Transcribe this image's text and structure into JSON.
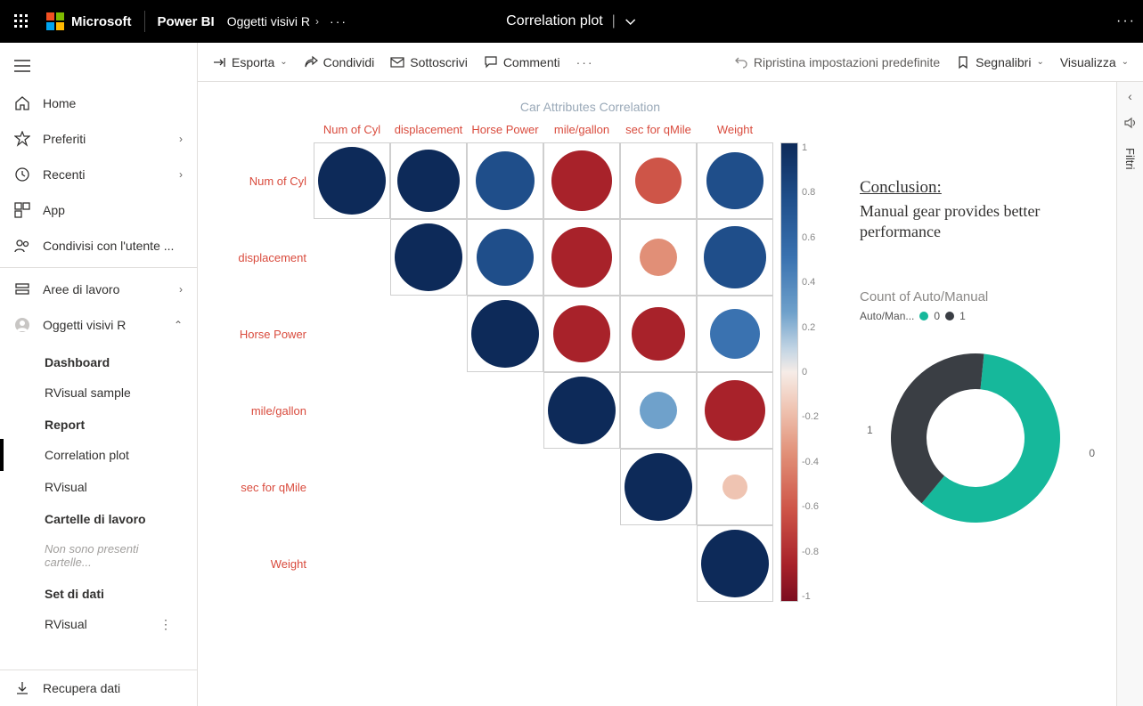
{
  "topbar": {
    "ms": "Microsoft",
    "brand": "Power BI",
    "breadcrumb": "Oggetti visivi R",
    "report_title": "Correlation plot"
  },
  "nav": {
    "home": "Home",
    "favorites": "Preferiti",
    "recent": "Recenti",
    "apps": "App",
    "shared": "Condivisi con l'utente ...",
    "workspaces": "Aree di lavoro",
    "current_ws": "Oggetti visivi R",
    "get_data": "Recupera dati"
  },
  "subnav": {
    "dashboard_head": "Dashboard",
    "dashboard_items": [
      "RVisual sample"
    ],
    "report_head": "Report",
    "report_items": [
      "Correlation plot",
      "RVisual"
    ],
    "report_active": "Correlation plot",
    "workbooks_head": "Cartelle di lavoro",
    "workbooks_empty": "Non sono presenti cartelle...",
    "datasets_head": "Set di dati",
    "datasets_items": [
      "RVisual"
    ]
  },
  "cmdbar": {
    "export": "Esporta",
    "share": "Condividi",
    "subscribe": "Sottoscrivi",
    "comments": "Commenti",
    "reset": "Ripristina impostazioni predefinite",
    "bookmarks": "Segnalibri",
    "view": "Visualizza"
  },
  "filter_rail": {
    "label": "Filtri"
  },
  "conclusion": {
    "title": "Conclusion:",
    "text": "Manual gear provides better performance"
  },
  "donut": {
    "title": "Count of Auto/Manual",
    "legend_name": "Auto/Man...",
    "legend": [
      {
        "label": "0",
        "color": "#16b89b"
      },
      {
        "label": "1",
        "color": "#3a3e44"
      }
    ]
  },
  "chart_data": [
    {
      "type": "heatmap",
      "title": "Car Attributes Correlation",
      "variables": [
        "Num of Cyl",
        "displacement",
        "Horse Power",
        "mile/gallon",
        "sec for qMile",
        "Weight"
      ],
      "matrix": [
        [
          1.0,
          0.9,
          0.83,
          -0.85,
          -0.59,
          0.78
        ],
        [
          0.9,
          1.0,
          0.79,
          -0.85,
          -0.43,
          0.89
        ],
        [
          0.83,
          0.79,
          1.0,
          -0.78,
          -0.71,
          0.66
        ],
        [
          -0.85,
          -0.85,
          -0.78,
          1.0,
          0.42,
          -0.87
        ],
        [
          -0.59,
          -0.43,
          -0.71,
          0.42,
          1.0,
          -0.17
        ],
        [
          0.78,
          0.89,
          0.66,
          -0.87,
          -0.17,
          1.0
        ]
      ],
      "scale_ticks": [
        "1",
        "0.8",
        "0.6",
        "0.4",
        "0.2",
        "0",
        "-0.2",
        "-0.4",
        "-0.6",
        "-0.8",
        "-1"
      ]
    },
    {
      "type": "pie",
      "title": "Count of Auto/Manual",
      "series": [
        {
          "name": "0",
          "value": 19,
          "color": "#16b89b"
        },
        {
          "name": "1",
          "value": 13,
          "color": "#3a3e44"
        }
      ]
    }
  ]
}
